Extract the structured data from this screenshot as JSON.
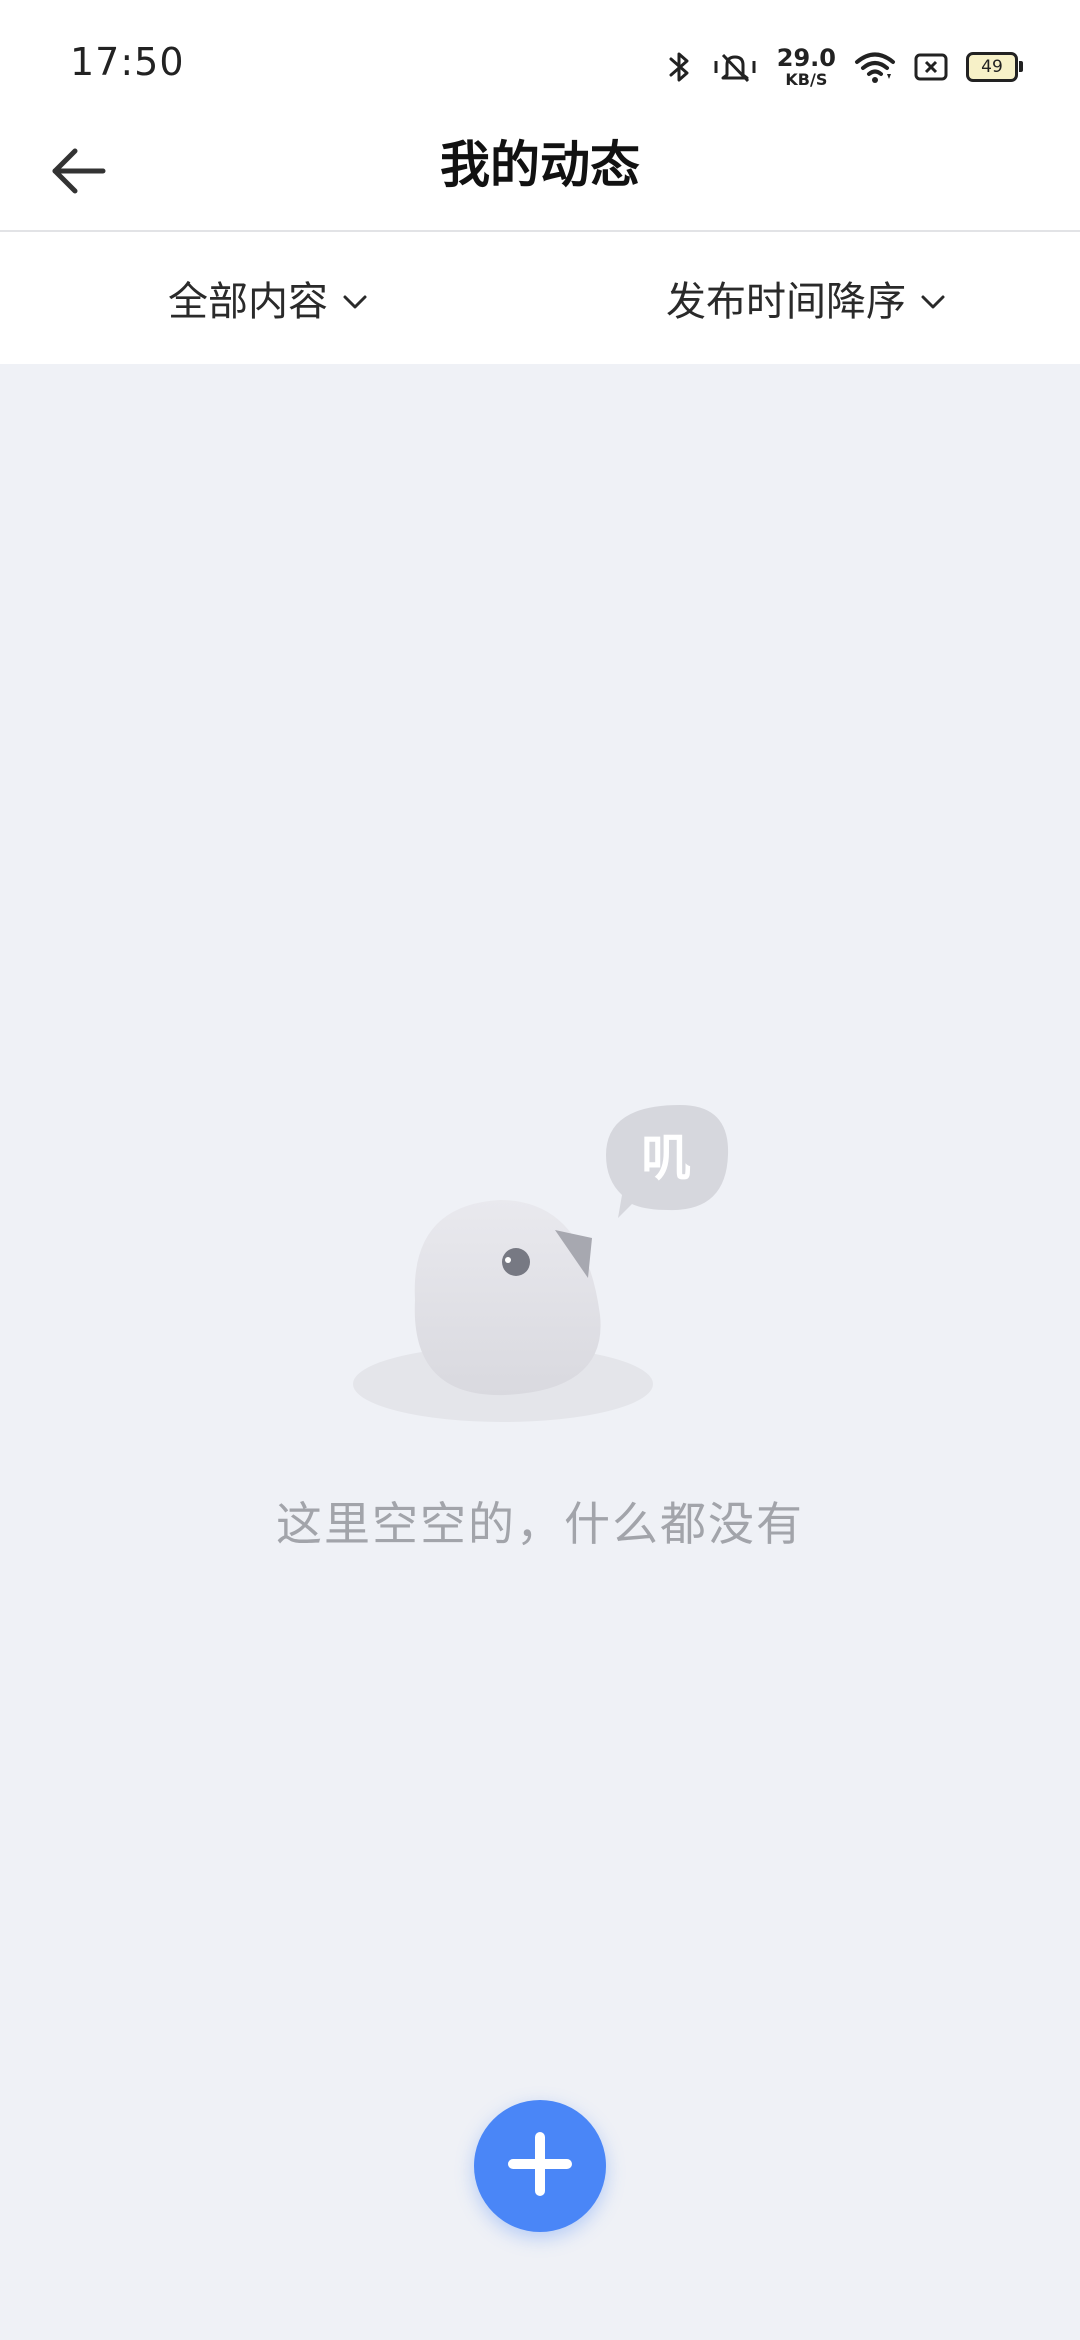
{
  "status_bar": {
    "time": "17:50",
    "net_speed_value": "29.0",
    "net_speed_unit": "KB/S",
    "battery_level": "49"
  },
  "nav": {
    "title": "我的动态",
    "back_icon": "arrow-left-icon"
  },
  "filters": {
    "content": "全部内容",
    "sort": "发布时间降序"
  },
  "empty_state": {
    "bubble_text": "叽",
    "message": "这里空空的，什么都没有"
  },
  "fab": {
    "icon": "plus-icon",
    "color": "#4a86f7"
  }
}
